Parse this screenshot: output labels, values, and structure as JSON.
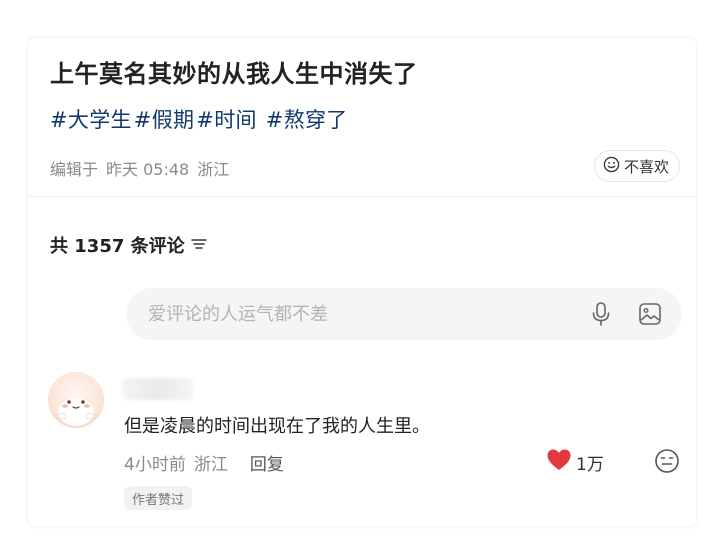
{
  "post": {
    "title": "上午莫名其妙的从我人生中消失了",
    "tags": [
      "#大学生",
      "#假期",
      "#时间",
      "#熬穿了"
    ],
    "meta": {
      "edited_label": "编辑于",
      "date": "昨天 05:48",
      "location": "浙江"
    },
    "dislike_label": "不喜欢"
  },
  "comments_section": {
    "count_label": "共 1357 条评论",
    "input_placeholder": "爱评论的人运气都不差"
  },
  "comment": {
    "username": "",
    "text": "但是凌晨的时间出现在了我的人生里。",
    "time": "4小时前",
    "location": "浙江",
    "reply_label": "回复",
    "like_count": "1万",
    "badge": "作者赞过"
  },
  "colors": {
    "tag": "#13386c",
    "heart": "#e0393e",
    "muted": "#8a8a8a"
  },
  "icons": [
    "smile-icon",
    "sort-icon",
    "microphone-icon",
    "image-icon",
    "heart-icon",
    "emoji-icon"
  ]
}
